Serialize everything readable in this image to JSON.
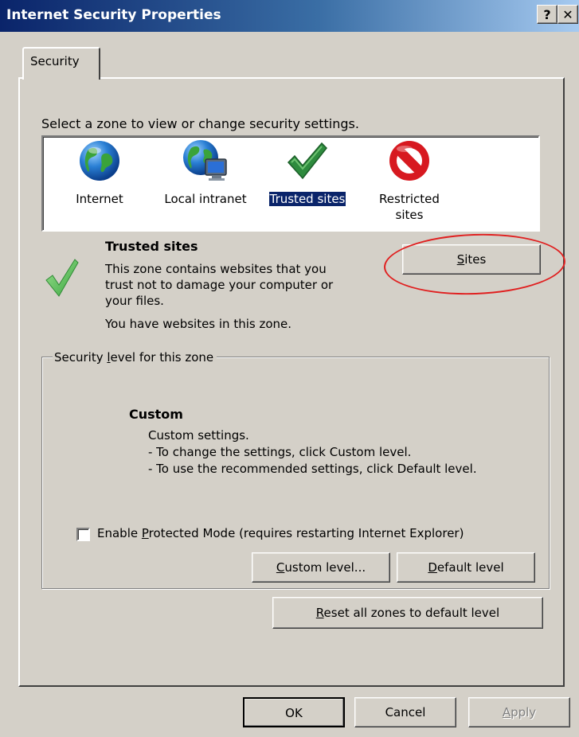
{
  "window": {
    "title": "Internet Security Properties",
    "help_glyph": "?",
    "close_glyph": "✕"
  },
  "tabs": [
    {
      "label": "Security",
      "selected": true
    }
  ],
  "zones_prompt": "Select a zone to view or change security settings.",
  "zones": [
    {
      "label": "Internet",
      "icon": "globe-icon"
    },
    {
      "label": "Local intranet",
      "icon": "intranet-globe-computer-icon"
    },
    {
      "label": "Trusted sites",
      "icon": "green-check-icon",
      "selected": true
    },
    {
      "label_line1": "Restricted",
      "label_line2": "sites",
      "icon": "no-entry-icon"
    }
  ],
  "zone_detail": {
    "title": "Trusted sites",
    "description_line1": "This zone contains websites that you",
    "description_line2": "trust not to damage your computer or",
    "description_line3": "your files.",
    "status": "You have websites in this zone.",
    "sites_button": {
      "accel": "S",
      "rest": "ites"
    }
  },
  "security_level": {
    "group_label": {
      "pre": "Security ",
      "accel": "l",
      "rest": "evel for this zone"
    },
    "level_name": "Custom",
    "desc_line1": "Custom settings.",
    "desc_line2": "- To change the settings, click Custom level.",
    "desc_line3": "- To use the recommended settings, click Default level.",
    "protected_mode": {
      "checked": false,
      "pre": "Enable ",
      "accel": "P",
      "rest": "rotected Mode (requires restarting Internet Explorer)"
    },
    "custom_level_button": {
      "accel": "C",
      "rest": "ustom level..."
    },
    "default_level_button": {
      "accel": "D",
      "rest": "efault level"
    }
  },
  "reset_button": {
    "accel": "R",
    "rest": "eset all zones to default level"
  },
  "dialog_buttons": {
    "ok": "OK",
    "cancel": "Cancel",
    "apply": {
      "accel": "A",
      "rest": "pply",
      "disabled": true
    }
  },
  "colors": {
    "face": "#d4d0c8",
    "title_start": "#0a246a",
    "title_end": "#a6caf0",
    "selection": "#0a246a",
    "annotation_oval": "#e02020"
  }
}
